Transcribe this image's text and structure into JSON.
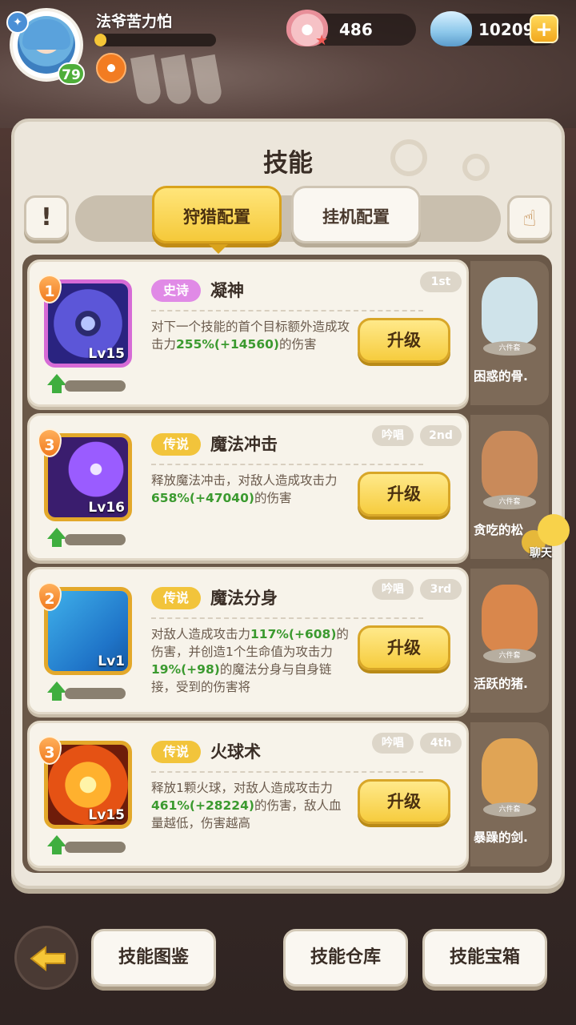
{
  "player": {
    "name": "法爷苦力怕",
    "level": "79",
    "exp_ratio": 0.1
  },
  "currencies": {
    "pearls": "486",
    "gems": "10209"
  },
  "panel": {
    "title": "技能",
    "info_icon": "!",
    "tabs": [
      {
        "label": "狩猎配置",
        "active": true
      },
      {
        "label": "挂机配置",
        "active": false
      }
    ]
  },
  "skills": [
    {
      "slot": "1",
      "rarity": "史诗",
      "name": "凝神",
      "order": "1st",
      "chant": "",
      "level": "Lv15",
      "desc_parts": [
        "对下一个技能的首个目标额外造成攻击力",
        "255%(+14560)",
        "的伤害"
      ],
      "upgrade_label": "升级",
      "icon": "eye-icon"
    },
    {
      "slot": "3",
      "rarity": "传说",
      "name": "魔法冲击",
      "order": "2nd",
      "chant": "吟唱",
      "level": "Lv16",
      "desc_parts": [
        "释放魔法冲击，对敌人造成攻击力",
        "658%(+47040)",
        "的伤害"
      ],
      "upgrade_label": "升级",
      "icon": "lightning-icon"
    },
    {
      "slot": "2",
      "rarity": "传说",
      "name": "魔法分身",
      "order": "3rd",
      "chant": "吟唱",
      "level": "Lv1",
      "desc_parts": [
        "对敌人造成攻击力",
        "117%(+608)",
        "的伤害，并创造1个生命值为攻击力",
        "19%(+98)",
        "的魔法分身与自身链接，受到的伤害将"
      ],
      "upgrade_label": "升级",
      "icon": "clone-icon"
    },
    {
      "slot": "3",
      "rarity": "传说",
      "name": "火球术",
      "order": "4th",
      "chant": "吟唱",
      "level": "Lv15",
      "desc_parts": [
        "释放1颗火球，对敌人造成攻击力",
        "461%(+28224)",
        "的伤害，敌人血量越低，伤害越高"
      ],
      "upgrade_label": "升级",
      "icon": "fireball-icon"
    }
  ],
  "companions": [
    {
      "name": "困惑的骨.",
      "base_label": "六件套",
      "color": "#cfe3ea"
    },
    {
      "name": "贪吃的松",
      "base_label": "六件套",
      "color": "#c98a5a"
    },
    {
      "name": "活跃的猪.",
      "base_label": "六件套",
      "color": "#d9874c"
    },
    {
      "name": "暴躁的剑.",
      "base_label": "六件套",
      "color": "#e0a455"
    }
  ],
  "chat": {
    "label": "聊天"
  },
  "bottom": {
    "btn1": "技能图鉴",
    "btn2": "技能仓库",
    "btn3": "技能宝箱"
  },
  "colors": {
    "accent_yellow": "#f5c93a",
    "epic_pink": "#e08ae6",
    "legend_gold": "#f2c43b",
    "value_green": "#3b9a2f"
  }
}
